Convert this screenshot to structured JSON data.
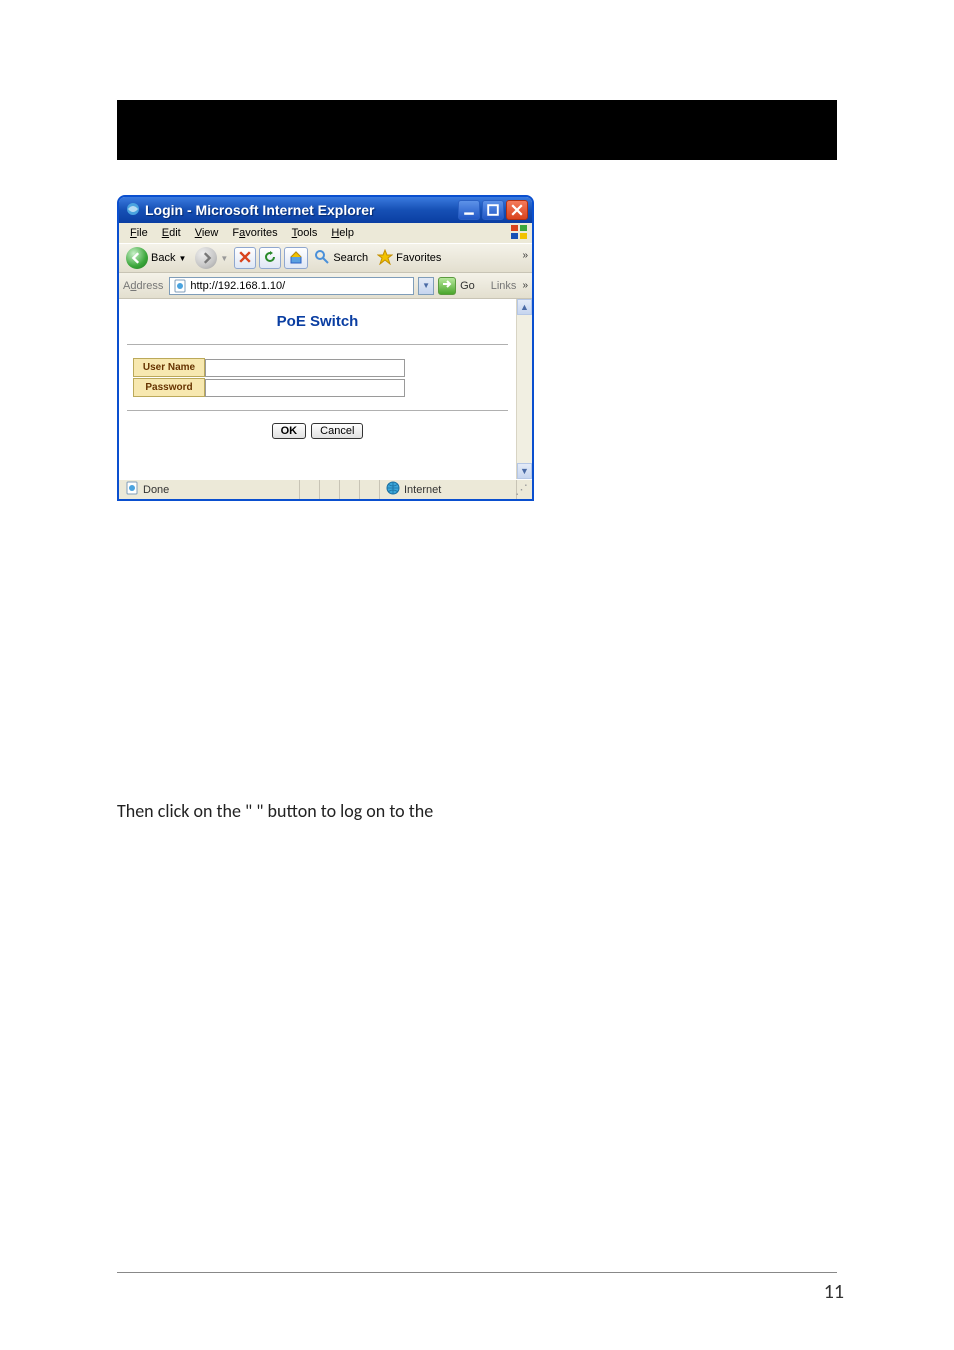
{
  "titlebar": {
    "text": "Login - Microsoft Internet Explorer"
  },
  "menubar": {
    "items": [
      {
        "pre": "",
        "u": "F",
        "post": "ile"
      },
      {
        "pre": "",
        "u": "E",
        "post": "dit"
      },
      {
        "pre": "",
        "u": "V",
        "post": "iew"
      },
      {
        "pre": "F",
        "u": "a",
        "post": "vorites"
      },
      {
        "pre": "",
        "u": "T",
        "post": "ools"
      },
      {
        "pre": "",
        "u": "H",
        "post": "elp"
      }
    ]
  },
  "toolbar": {
    "back_label": "Back",
    "search_label": "Search",
    "favorites_label": "Favorites"
  },
  "addressbar": {
    "label_pre": "A",
    "label_u": "d",
    "label_post": "dress",
    "url": "http://192.168.1.10/",
    "go_label": "Go",
    "links_label": "Links"
  },
  "page": {
    "heading": "PoE Switch",
    "username_label": "User Name",
    "password_label": "Password",
    "ok_label": "OK",
    "cancel_label": "Cancel"
  },
  "statusbar": {
    "done_label": "Done",
    "zone_label": "Internet"
  },
  "body_text": "Then click on the \"     \" button to log on to the",
  "page_number": "11"
}
